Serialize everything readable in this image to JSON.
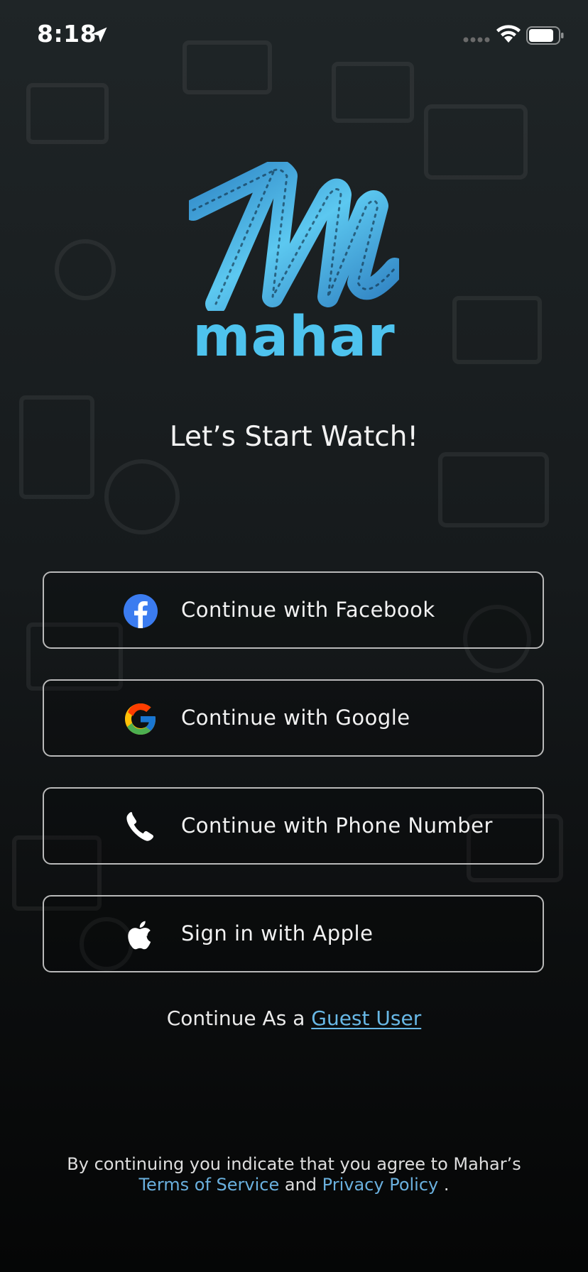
{
  "status_bar": {
    "time": "8:18",
    "location_icon": "location-arrow-icon",
    "signal_icon": "cellular-dots-icon",
    "wifi_icon": "wifi-icon",
    "battery_icon": "battery-icon"
  },
  "brand": {
    "logo_icon": "film-strip-m-logo-icon",
    "name": "mahar",
    "color": "#4ec3ee"
  },
  "tagline": "Let’s Start Watch!",
  "auth_buttons": [
    {
      "label": "Continue with Facebook",
      "icon": "facebook-icon"
    },
    {
      "label": "Continue with Google",
      "icon": "google-icon"
    },
    {
      "label": "Continue with Phone Number",
      "icon": "phone-icon"
    },
    {
      "label": "Sign in with Apple",
      "icon": "apple-icon"
    }
  ],
  "guest": {
    "prefix": "Continue As a",
    "link": "Guest User"
  },
  "legal": {
    "line1": "By continuing you indicate that you agree to Mahar’s",
    "terms": "Terms of Service",
    "and": "and",
    "privacy": "Privacy Policy",
    "period": "."
  },
  "colors": {
    "link": "#68b8e6",
    "button_border": "#b9b9b9",
    "facebook": "#3b7cf0"
  }
}
